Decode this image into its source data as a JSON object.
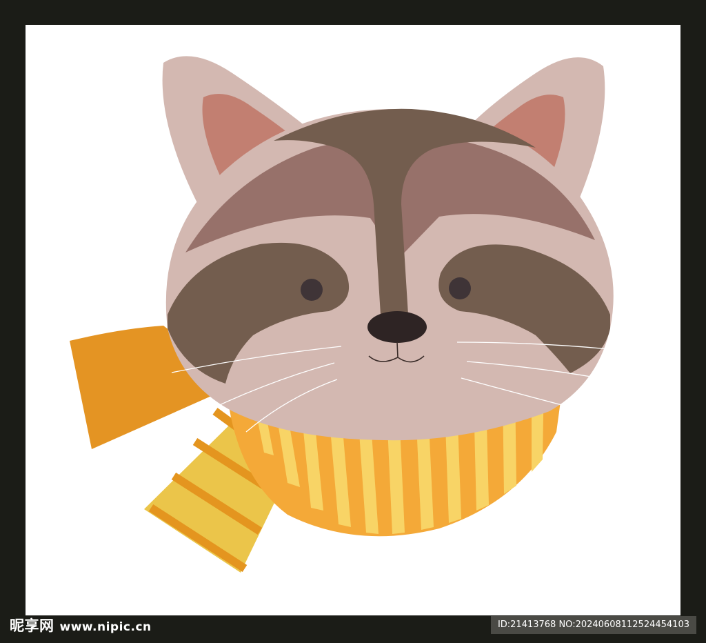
{
  "watermark": {
    "site_name_cn": "昵享网",
    "site_url": "www.nipic.cn",
    "image_id": "ID:21413768 NO:20240608112524454103"
  },
  "colors": {
    "frame": "#1b1c17",
    "background": "#ffffff",
    "fur_dark": "#735d4e",
    "fur_mid": "#97716a",
    "fur_light": "#d3b8b1",
    "ear_inner": "#c27f71",
    "nose": "#2e2424",
    "eye": "#3f3437",
    "scarf_orange": "#e49423",
    "scarf_yellow": "#f8d466",
    "scarf_stripe": "#f4a938"
  },
  "icons": {
    "main": "raccoon-illustration"
  }
}
